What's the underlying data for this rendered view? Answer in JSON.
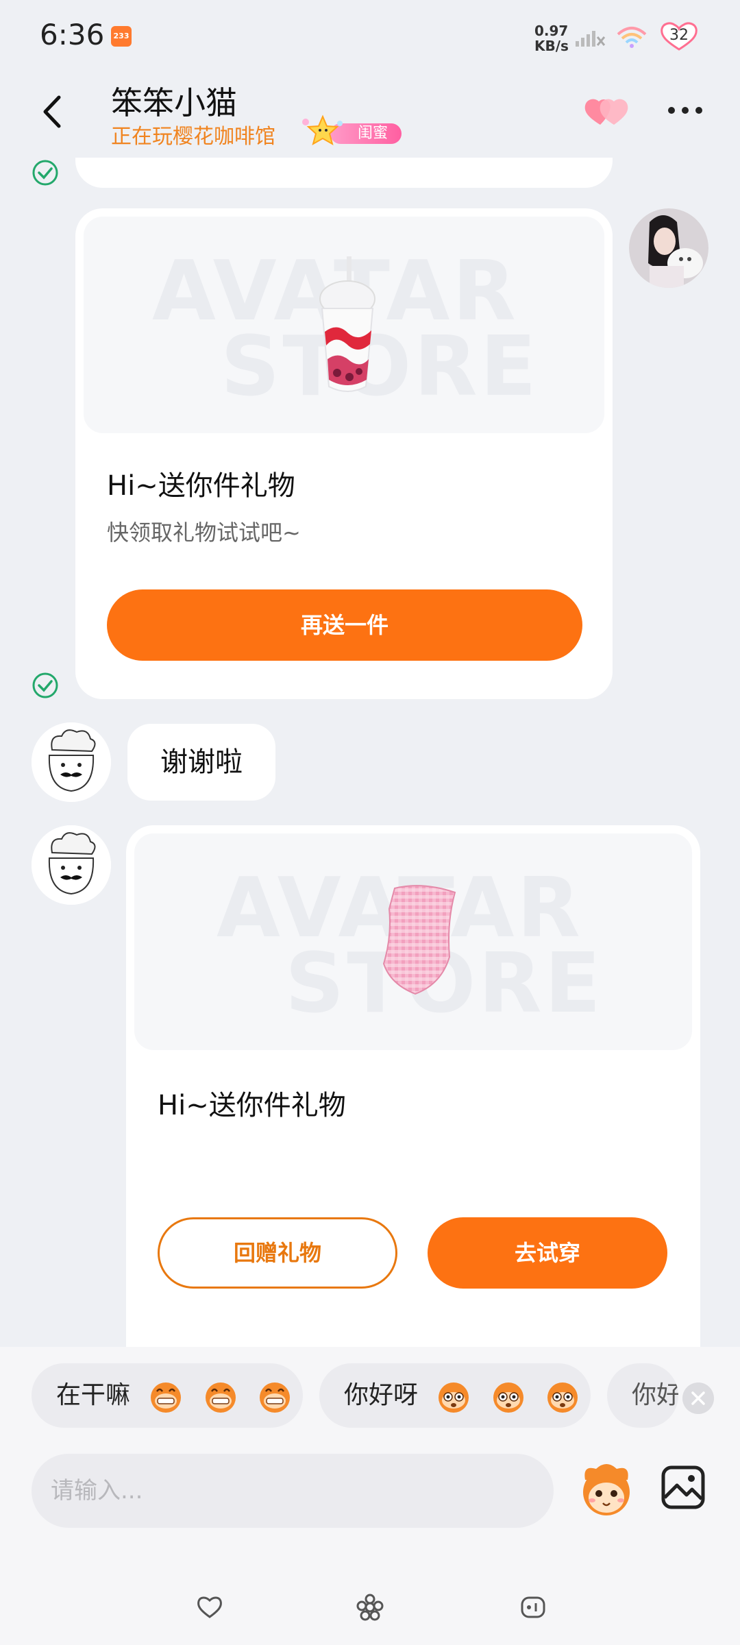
{
  "status_bar": {
    "time": "6:36",
    "net_speed_value": "0.97",
    "net_speed_unit": "KB/s",
    "battery": "32"
  },
  "header": {
    "contact_name": "笨笨小猫",
    "activity": "正在玩樱花咖啡馆",
    "relation_badge": "闺蜜"
  },
  "messages": [
    {
      "type": "gift",
      "side": "right",
      "image": "bubble-tea-cup",
      "watermark": [
        "AVATAR",
        "STORE"
      ],
      "title": "Hi~送你件礼物",
      "subtitle": "快领取礼物试试吧~",
      "button": "再送一件"
    },
    {
      "type": "text",
      "side": "left",
      "text": "谢谢啦"
    },
    {
      "type": "gift",
      "side": "left",
      "image": "pink-plaid-scarf",
      "watermark": [
        "AVATAR",
        "STORE"
      ],
      "title": "Hi~送你件礼物",
      "buttons": [
        "回赠礼物",
        "去试穿"
      ]
    }
  ],
  "quick_replies": [
    {
      "text": "在干嘛",
      "emoji": "grin-monkey-icon"
    },
    {
      "text": "你好呀",
      "emoji": "wide-eye-monkey-icon"
    },
    {
      "text": "你好"
    }
  ],
  "input": {
    "placeholder": "请输入..."
  },
  "colors": {
    "accent_orange": "#fd7212",
    "background": "#eef0f4",
    "sent_check": "#23a86b"
  }
}
